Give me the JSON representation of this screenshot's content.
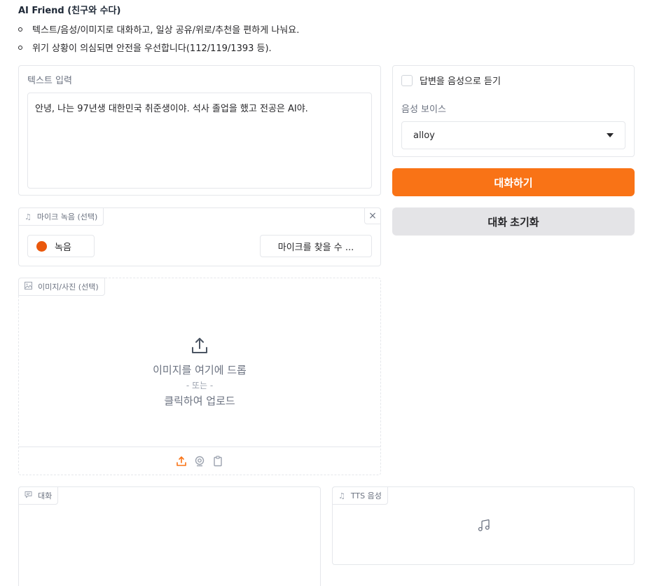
{
  "header": {
    "title": "AI Friend (친구와 수다)",
    "bullets": [
      "텍스트/음성/이미지로 대화하고, 일상 공유/위로/추천을 편하게 나눠요.",
      "위기 상황이 의심되면 안전을 우선합니다(112/119/1393 등)."
    ]
  },
  "text_input": {
    "label": "텍스트 입력",
    "value": "안녕, 나는 97년생 대한민국 취준생이야. 석사 졸업을 했고 전공은 AI야."
  },
  "voice_options": {
    "checkbox_label": "답변을 음성으로 듣기",
    "voice_label": "음성 보이스",
    "voice_selected": "alloy"
  },
  "buttons": {
    "chat": "대화하기",
    "reset": "대화 초기화"
  },
  "mic": {
    "label": "마이크 녹음 (선택)",
    "record": "녹음",
    "device": "마이크를 찾을 수 ...",
    "close": "×"
  },
  "image": {
    "label": "이미지/사진 (선택)",
    "drop": "이미지를 여기에 드롭",
    "or": "- 또는 -",
    "click": "클릭하여 업로드"
  },
  "chat_panel": {
    "label": "대화"
  },
  "tts_panel": {
    "label": "TTS 음성"
  },
  "colors": {
    "accent": "#f97316",
    "record_dot": "#ea580c",
    "secondary_button": "#e4e4e7"
  }
}
